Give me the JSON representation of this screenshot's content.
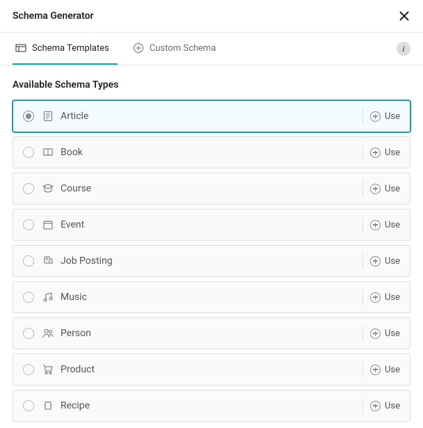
{
  "header": {
    "title": "Schema Generator"
  },
  "tabs": [
    {
      "label": "Schema Templates",
      "active": true,
      "icon": "templates-icon"
    },
    {
      "label": "Custom Schema",
      "active": false,
      "icon": "plus-circle-icon"
    }
  ],
  "section_heading": "Available Schema Types",
  "use_label": "Use",
  "items": [
    {
      "label": "Article",
      "icon": "article-icon",
      "selected": true
    },
    {
      "label": "Book",
      "icon": "book-icon",
      "selected": false
    },
    {
      "label": "Course",
      "icon": "course-icon",
      "selected": false
    },
    {
      "label": "Event",
      "icon": "event-icon",
      "selected": false
    },
    {
      "label": "Job Posting",
      "icon": "job-icon",
      "selected": false
    },
    {
      "label": "Music",
      "icon": "music-icon",
      "selected": false
    },
    {
      "label": "Person",
      "icon": "person-icon",
      "selected": false
    },
    {
      "label": "Product",
      "icon": "product-icon",
      "selected": false
    },
    {
      "label": "Recipe",
      "icon": "recipe-icon",
      "selected": false
    }
  ]
}
